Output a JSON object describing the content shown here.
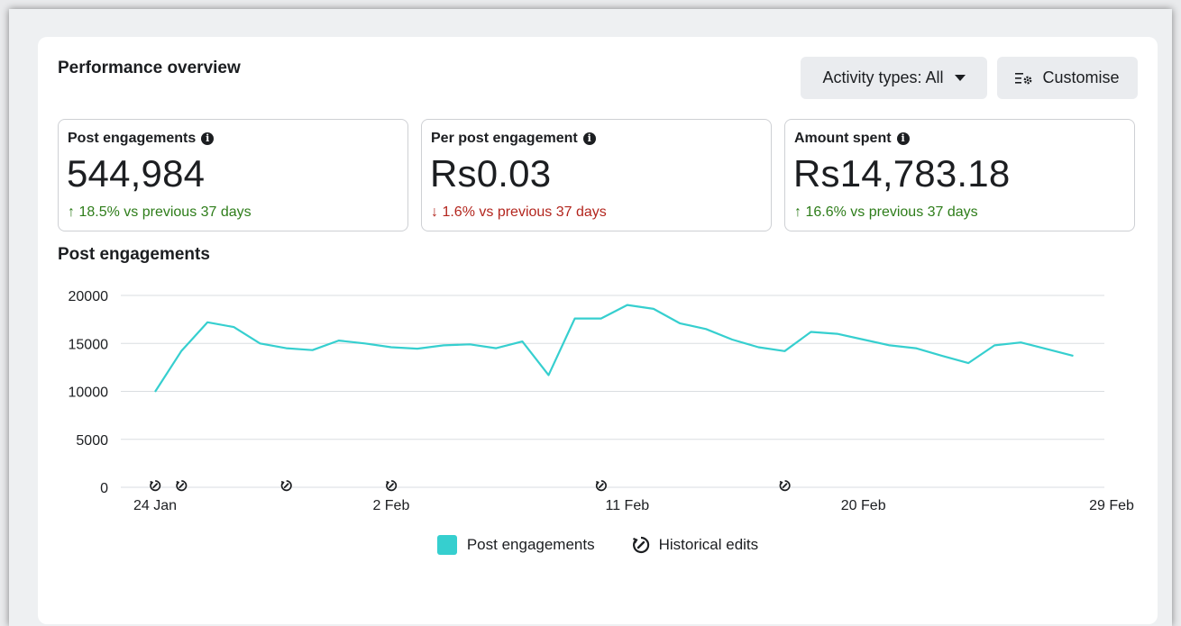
{
  "header": {
    "title": "Performance overview",
    "activity_button": "Activity types: All",
    "customise_button": "Customise"
  },
  "metrics": [
    {
      "label": "Post engagements",
      "value": "544,984",
      "delta": "18.5% vs previous 37 days",
      "direction": "up",
      "arrow": "↑"
    },
    {
      "label": "Per post engagement",
      "value": "Rs0.03",
      "delta": "1.6% vs previous 37 days",
      "direction": "down",
      "arrow": "↓"
    },
    {
      "label": "Amount spent",
      "value": "Rs14,783.18",
      "delta": "16.6% vs previous 37 days",
      "direction": "up",
      "arrow": "↑"
    }
  ],
  "chart_title": "Post engagements",
  "legend": {
    "series_label": "Post engagements",
    "edits_label": "Historical edits"
  },
  "colors": {
    "series": "#36cfcf",
    "up": "#2e7d1a",
    "down": "#b3261e"
  },
  "chart_data": {
    "type": "line",
    "x_start": "24 Jan",
    "x_tick_labels": [
      "24 Jan",
      "2 Feb",
      "11 Feb",
      "20 Feb",
      "29 Feb"
    ],
    "y_ticks": [
      0,
      5000,
      10000,
      15000,
      20000
    ],
    "ylim": [
      0,
      20000
    ],
    "grid": true,
    "legend_position": "bottom",
    "series": [
      {
        "name": "Post engagements",
        "x": [
          "24 Jan",
          "25 Jan",
          "26 Jan",
          "27 Jan",
          "28 Jan",
          "29 Jan",
          "30 Jan",
          "31 Jan",
          "1 Feb",
          "2 Feb",
          "3 Feb",
          "4 Feb",
          "5 Feb",
          "6 Feb",
          "7 Feb",
          "8 Feb",
          "9 Feb",
          "10 Feb",
          "11 Feb",
          "12 Feb",
          "13 Feb",
          "14 Feb",
          "15 Feb",
          "16 Feb",
          "17 Feb",
          "18 Feb",
          "19 Feb",
          "20 Feb",
          "21 Feb",
          "22 Feb",
          "23 Feb",
          "24 Feb",
          "25 Feb",
          "26 Feb",
          "27 Feb",
          "28 Feb"
        ],
        "values": [
          9950,
          14200,
          17200,
          16700,
          15000,
          14500,
          14300,
          15300,
          15000,
          14600,
          14450,
          14800,
          14900,
          14500,
          15200,
          11700,
          17600,
          17600,
          19000,
          18600,
          17100,
          16500,
          15400,
          14600,
          14200,
          16200,
          16000,
          15400,
          14800,
          14500,
          13700,
          12950,
          14800,
          15100,
          14400,
          13700
        ]
      }
    ],
    "historical_edits": [
      "24 Jan",
      "25 Jan",
      "29 Jan",
      "2 Feb",
      "10 Feb",
      "17 Feb"
    ]
  }
}
